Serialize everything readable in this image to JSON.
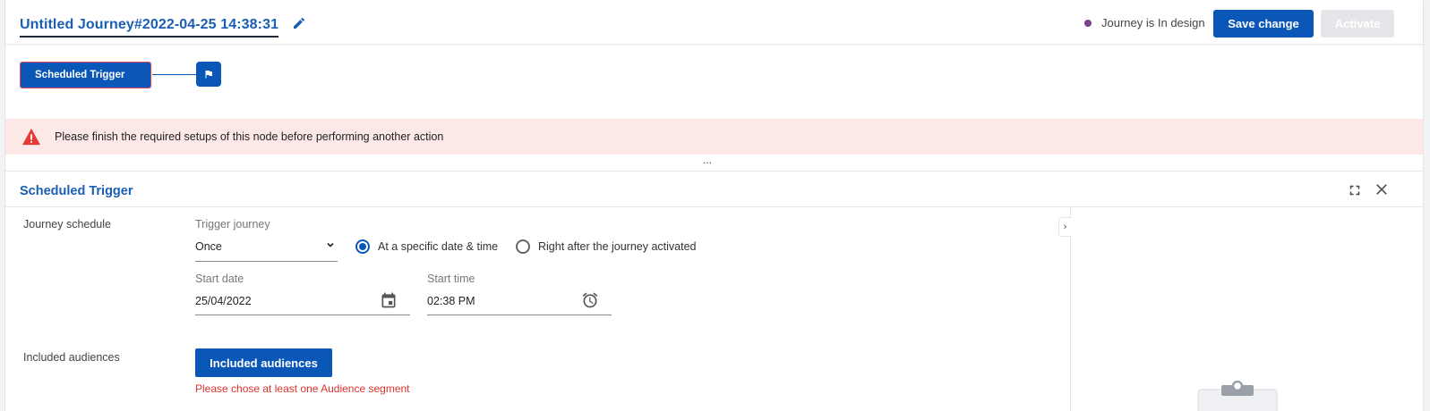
{
  "header": {
    "journey_title": "Untitled Journey#2022-04-25 14:38:31",
    "status_text": "Journey is In design",
    "status_color": "#7b3f8c",
    "save_label": "Save change",
    "activate_label": "Activate"
  },
  "canvas": {
    "trigger_node_label": "Scheduled Trigger",
    "end_node_icon": "flag-icon"
  },
  "alert": {
    "icon": "warning-triangle-icon",
    "message": "Please finish the required setups of this node before performing another action"
  },
  "splitter": {
    "label": "..."
  },
  "panel": {
    "title": "Scheduled Trigger",
    "side_toggle": "›",
    "journey_schedule": {
      "label": "Journey schedule",
      "trigger_label": "Trigger journey",
      "trigger_value": "Once",
      "radio_specific": "At a specific date & time",
      "radio_after": "Right after the journey activated",
      "selected_option": "At a specific date & time",
      "start_date_label": "Start date",
      "start_date_value": "25/04/2022",
      "start_time_label": "Start time",
      "start_time_value": "02:38 PM"
    },
    "audiences": {
      "label": "Included audiences",
      "button_label": "Included audiences",
      "error": "Please chose at least one Audience segment"
    }
  },
  "colors": {
    "primary": "#0b57b8",
    "title_blue": "#1a5fb4",
    "alert_bg": "#fde8e8",
    "error_red": "#e0322d",
    "disabled_bg": "#e4e6e9"
  }
}
